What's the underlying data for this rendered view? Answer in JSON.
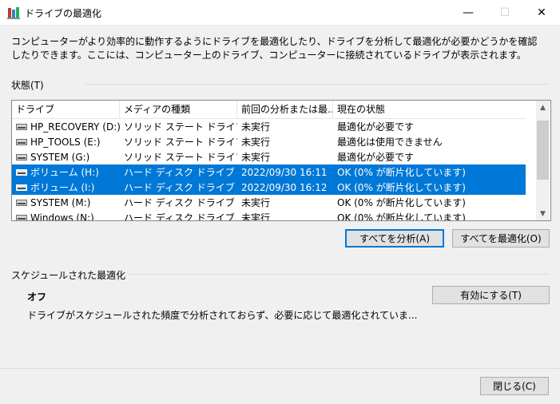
{
  "window": {
    "title": "ドライブの最適化",
    "min_glyph": "—",
    "max_glyph": "☐",
    "close_glyph": "✕"
  },
  "description": "コンピューターがより効率的に動作するようにドライブを最適化したり、ドライブを分析して最適化が必要かどうかを確認したりできます。ここには、コンピューター上のドライブ、コンピューターに接続されているドライブが表示されます。",
  "status_label": "状態(T)",
  "table": {
    "columns": [
      "ドライブ",
      "メディアの種類",
      "前回の分析または最…",
      "現在の状態"
    ],
    "rows": [
      {
        "drive": "HP_RECOVERY (D:)",
        "media": "ソリッド ステート ドライブ",
        "last": "未実行",
        "status": "最適化が必要です",
        "selected": false
      },
      {
        "drive": "HP_TOOLS (E:)",
        "media": "ソリッド ステート ドライブ",
        "last": "未実行",
        "status": "最適化は使用できません",
        "selected": false
      },
      {
        "drive": "SYSTEM (G:)",
        "media": "ソリッド ステート ドライブ",
        "last": "未実行",
        "status": "最適化が必要です",
        "selected": false
      },
      {
        "drive": "ボリューム (H:)",
        "media": "ハード ディスク ドライブ",
        "last": "2022/09/30 16:11",
        "status": "OK (0% が断片化しています)",
        "selected": true
      },
      {
        "drive": "ボリューム (I:)",
        "media": "ハード ディスク ドライブ",
        "last": "2022/09/30 16:12",
        "status": "OK (0% が断片化しています)",
        "selected": true
      },
      {
        "drive": "SYSTEM (M:)",
        "media": "ハード ディスク ドライブ",
        "last": "未実行",
        "status": "OK (0% が断片化しています)",
        "selected": false
      },
      {
        "drive": "Windows (N:)",
        "media": "ハード ディスク ドライブ",
        "last": "未実行",
        "status": "OK (0% が断片化しています)",
        "selected": false
      }
    ]
  },
  "buttons": {
    "analyze_all": "すべてを分析(A)",
    "optimize_all": "すべてを最適化(O)",
    "enable": "有効にする(T)",
    "close": "閉じる(C)"
  },
  "schedule": {
    "label": "スケジュールされた最適化",
    "status": "オフ",
    "description": "ドライブがスケジュールされた頻度で分析されておらず、必要に応じて最適化されていま..."
  },
  "colors": {
    "selection": "#0078d7",
    "background": "#f0f0f0"
  }
}
